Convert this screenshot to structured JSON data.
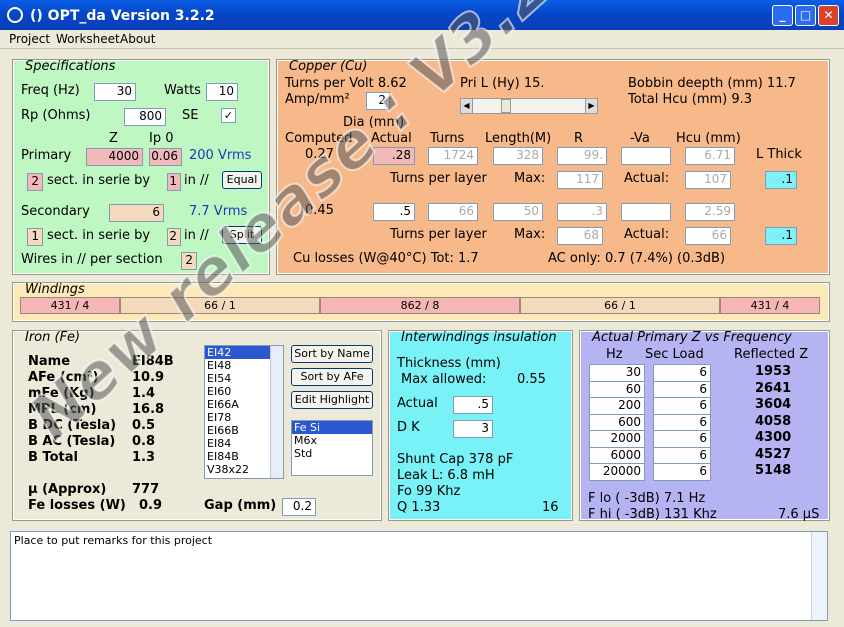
{
  "window": {
    "title": "()  OPT_da Version 3.2.2"
  },
  "menu": [
    "Project",
    "Worksheet",
    "About"
  ],
  "spec": {
    "legend": "Specifications",
    "freq_label": "Freq (Hz)",
    "freq": "30",
    "watts_label": "Watts",
    "watts": "10",
    "rp_label": "Rp (Ohms)",
    "rp": "800",
    "se_label": "SE",
    "se_check": "✓",
    "z_label": "Z",
    "ip_label": "Ip 0",
    "primary_label": "Primary",
    "primary_z": "4000",
    "primary_ip": "0.06",
    "primary_vrms": "200 Vrms",
    "p_sect": "2",
    "sect_text": "sect. in serie by",
    "p_par": "1",
    "in_par": "in //",
    "equal_btn": "Equal",
    "secondary_label": "Secondary",
    "secondary_z": "6",
    "secondary_vrms": "7.7 Vrms",
    "s_sect": "1",
    "s_par": "2",
    "split_btn": "Split",
    "wires_label": "Wires in // per section",
    "wires": "2"
  },
  "copper": {
    "legend": "Copper (Cu)",
    "tpv": "Turns per Volt  8.62",
    "amp_label": "Amp/mm²",
    "amp": "2",
    "pril": "Pri L (Hy)  15.",
    "bobbin": "Bobbin deepth (mm) 11.7",
    "totalhcu": "Total Hcu (mm)      9.3",
    "dia": "Dia (mm)",
    "computed": "Computed",
    "actual": "Actual",
    "turns": "Turns",
    "length": "Length(M)",
    "r": "R",
    "va": "-Va",
    "hcu": "Hcu (mm)",
    "thick": "L Thick",
    "r1_comp": "0.27",
    "r1_act": ".28",
    "r1_turns": "1724",
    "r1_len": "328",
    "r1_r": "99.",
    "r1_va": "",
    "r1_hcu": "6.71",
    "tpl": "Turns per layer",
    "max": "Max:",
    "r1_max": "117",
    "actual2": "Actual:",
    "r1_actual": "107",
    "r1_thick": ".1",
    "r2_comp": "0.45",
    "r2_act": ".5",
    "r2_turns": "66",
    "r2_len": "50",
    "r2_r": ".3",
    "r2_va": "",
    "r2_hcu": "2.59",
    "r2_max": "68",
    "r2_actual": "66",
    "r2_thick": ".1",
    "culoss": "Cu losses (W@40°C) Tot:    1.7",
    "acuonly": "AC only:  0.7      (7.4%)           (0.3dB)"
  },
  "windings": {
    "legend": "Windings",
    "cells": [
      "431 / 4",
      "66 / 1",
      "862 / 8",
      "66 / 1",
      "431 / 4"
    ]
  },
  "iron": {
    "legend": "Iron (Fe)",
    "rows": [
      [
        "Name",
        "EI84B"
      ],
      [
        "AFe (cm²)",
        "10.9"
      ],
      [
        "mFe (Kg)",
        "1.4"
      ],
      [
        "MPL (cm)",
        "16.8"
      ],
      [
        "B DC (Tesla)",
        "0.5"
      ],
      [
        "B AC (Tesla)",
        "0.8"
      ],
      [
        "B Total",
        "1.3"
      ]
    ],
    "mu_label": "µ (Approx)",
    "mu": "777",
    "fel_label": "Fe losses (W)",
    "fel": "0.9",
    "gap_label": "Gap (mm)",
    "gap": "0.2",
    "cores": [
      "EI42",
      "EI48",
      "EI54",
      "EI60",
      "EI66A",
      "EI78",
      "EI66B",
      "EI84",
      "EI84B",
      "V38x22"
    ],
    "sort_name": "Sort by Name",
    "sort_afe": "Sort by AFe",
    "edit": "Edit Highlight",
    "mats": [
      "Fe Si",
      "M6x",
      "Std"
    ]
  },
  "insul": {
    "legend": "Interwindings insulation",
    "thick": "Thickness (mm)",
    "maxallow": "Max allowed:",
    "maxval": "0.55",
    "actual": "Actual",
    "actval": ".5",
    "dk": "D K",
    "dkval": "3",
    "shunt": "Shunt Cap    378 pF",
    "leak": "Leak L:         6.8 mH",
    "fo": "Fo                99 Khz",
    "q": "Q                1.33",
    "qn": "16"
  },
  "freqresp": {
    "legend": "Actual Primary Z vs Frequency",
    "hz": "Hz",
    "sec": "Sec Load",
    "refl": "Reflected Z",
    "rows": [
      [
        "30",
        "6",
        "1953"
      ],
      [
        "60",
        "6",
        "2641"
      ],
      [
        "200",
        "6",
        "3604"
      ],
      [
        "600",
        "6",
        "4058"
      ],
      [
        "2000",
        "6",
        "4300"
      ],
      [
        "6000",
        "6",
        "4527"
      ],
      [
        "20000",
        "6",
        "5148"
      ]
    ],
    "flo": "F lo ( -3dB) 7.1 Hz",
    "fhi": "F hi ( -3dB) 131 Khz",
    "us": "7.6 µS"
  },
  "notes": {
    "text": "Place to put remarks for this project"
  },
  "watermark": "New release : V3.2.2"
}
